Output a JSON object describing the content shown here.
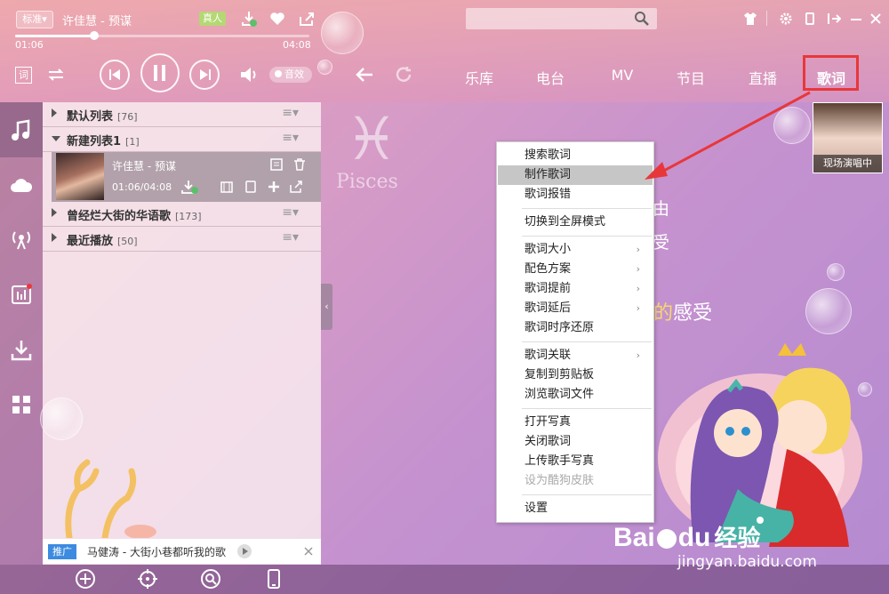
{
  "player": {
    "quality": "标准",
    "now_playing": "许佳慧 - 预谋",
    "real_person_badge": "真人",
    "time_current": "01:06",
    "time_total": "04:08",
    "progress": 0.27,
    "lyric_mode_label": "词",
    "sound_effect_label": "音效"
  },
  "search": {
    "placeholder": ""
  },
  "nav": {
    "tabs": [
      "乐库",
      "电台",
      "MV",
      "节目",
      "直播",
      "歌词"
    ],
    "active": "歌词"
  },
  "playlists": [
    {
      "name": "默认列表",
      "count": "[76]",
      "expanded": false
    },
    {
      "name": "新建列表1",
      "count": "[1]",
      "expanded": true
    },
    {
      "name": "曾经烂大街的华语歌",
      "count": "[173]",
      "expanded": false
    },
    {
      "name": "最近播放",
      "count": "[50]",
      "expanded": false
    }
  ],
  "song": {
    "title": "许佳慧 - 预谋",
    "time": "01:06/04:08"
  },
  "ad": {
    "tag": "推广",
    "text": "马健涛 - 大街小巷都听我的歌"
  },
  "context_menu": {
    "items": [
      {
        "label": "搜索歌词"
      },
      {
        "label": "制作歌词",
        "highlighted": true
      },
      {
        "label": "歌词报错"
      },
      {
        "label": "切换到全屏模式"
      },
      {
        "label": "歌词大小",
        "submenu": true
      },
      {
        "label": "配色方案",
        "submenu": true
      },
      {
        "label": "歌词提前",
        "submenu": true
      },
      {
        "label": "歌词延后",
        "submenu": true
      },
      {
        "label": "歌词时序还原"
      },
      {
        "label": "歌词关联",
        "submenu": true
      },
      {
        "label": "复制到剪贴板"
      },
      {
        "label": "浏览歌词文件"
      },
      {
        "label": "打开写真"
      },
      {
        "label": "关闭歌词"
      },
      {
        "label": "上传歌手写真"
      },
      {
        "label": "设为酷狗皮肤",
        "disabled": true
      },
      {
        "label": "设置"
      }
    ]
  },
  "lyrics": {
    "line1": "由",
    "line2": "受",
    "line3_a": "的",
    "line3_b": "感受"
  },
  "live": {
    "label": "现场演唱中"
  },
  "decor": {
    "zodiac": "Pisces"
  },
  "watermark": {
    "brand": "Bai",
    "brand2": "du",
    "cn": "经验",
    "url": "jingyan.baidu.com"
  },
  "colors": {
    "highlight_box": "#e8373a",
    "arrow": "#e8373a",
    "ad_tag": "#3c8be0",
    "menu_hover": "#c6c6c6"
  }
}
